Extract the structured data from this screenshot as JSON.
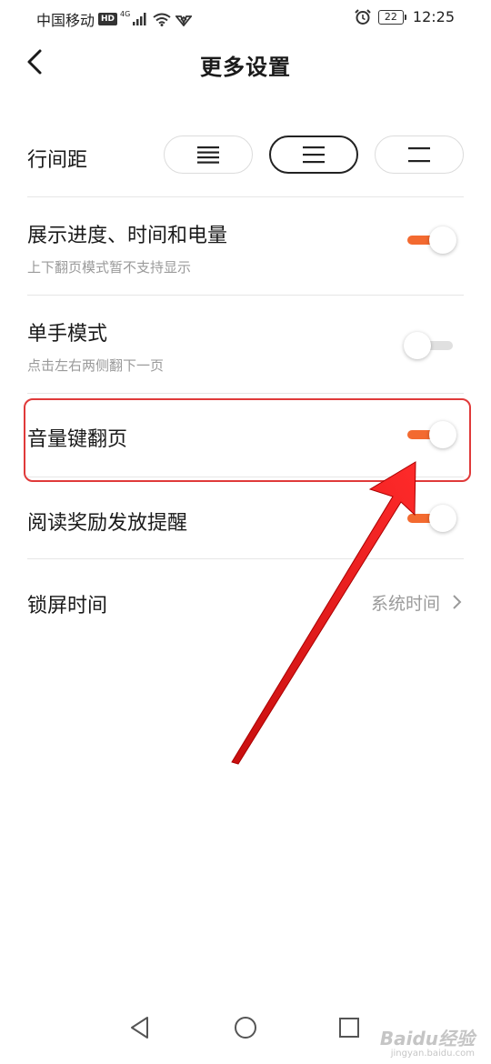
{
  "status_bar": {
    "carrier": "中国移动",
    "hd": "HD",
    "network": "4G",
    "battery": "22",
    "time": "12:25"
  },
  "header": {
    "title": "更多设置"
  },
  "settings": {
    "line_spacing": {
      "label": "行间距",
      "selected_index": 1
    },
    "show_progress": {
      "title": "展示进度、时间和电量",
      "subtitle": "上下翻页模式暂不支持显示",
      "enabled": true
    },
    "one_hand_mode": {
      "title": "单手模式",
      "subtitle": "点击左右两侧翻下一页",
      "enabled": false
    },
    "volume_key_paging": {
      "title": "音量键翻页",
      "enabled": true
    },
    "reward_reminder": {
      "title": "阅读奖励发放提醒",
      "enabled": true
    },
    "lock_screen_time": {
      "title": "锁屏时间",
      "value": "系统时间"
    }
  },
  "colors": {
    "accent": "#f36a30",
    "annotation": "#e03a3a"
  },
  "watermark": {
    "brand": "Baidu经验",
    "url": "jingyan.baidu.com"
  }
}
